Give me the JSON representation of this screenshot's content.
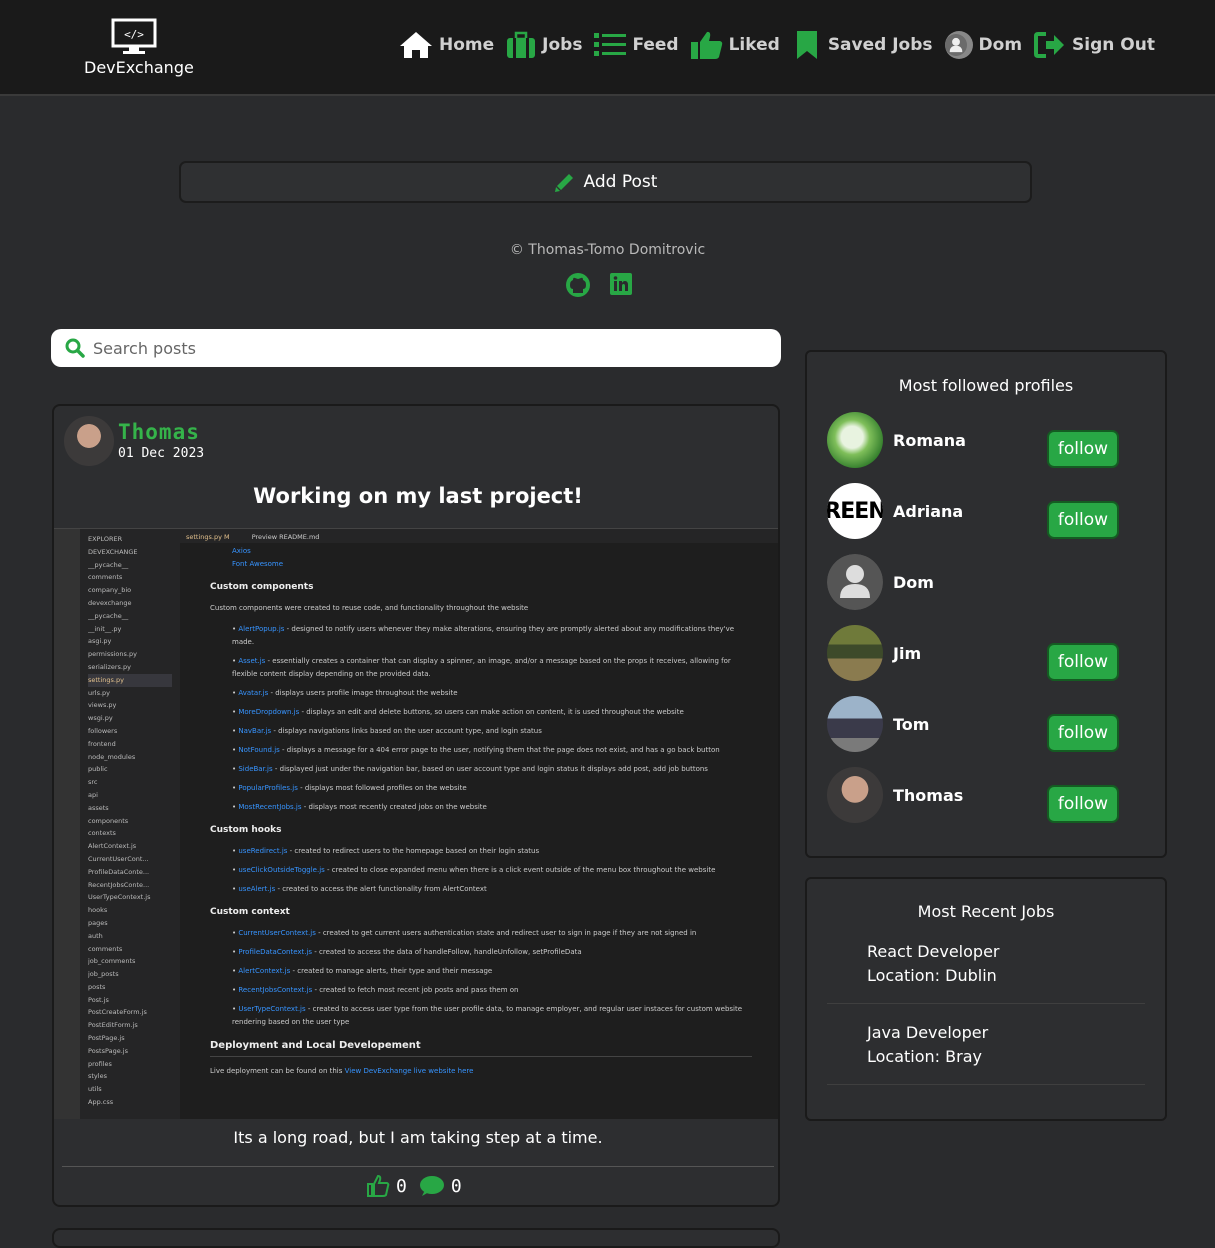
{
  "brand": {
    "name": "DevExchange"
  },
  "nav": {
    "items": [
      {
        "label": "Home",
        "icon": "home-icon"
      },
      {
        "label": "Jobs",
        "icon": "briefcase-icon"
      },
      {
        "label": "Feed",
        "icon": "list-icon"
      },
      {
        "label": "Liked",
        "icon": "thumbs-up-icon"
      },
      {
        "label": "Saved Jobs",
        "icon": "bookmark-icon"
      },
      {
        "label": "Dom",
        "icon": "avatar"
      },
      {
        "label": "Sign Out",
        "icon": "sign-out-icon"
      }
    ]
  },
  "add_post": {
    "label": "Add Post"
  },
  "footer": {
    "copyright": "© Thomas-Tomo Domitrovic"
  },
  "search": {
    "placeholder": "Search posts",
    "value": ""
  },
  "post": {
    "author": "Thomas",
    "date": "01 Dec 2023",
    "title": "Working on my last project!",
    "text": "Its a long road, but I am taking step at a time.",
    "likes": "0",
    "comments": "0"
  },
  "editor": {
    "tab1": "settings.py M",
    "tab2": "Preview README.md",
    "explorer": [
      "EXPLORER",
      "DEVEXCHANGE",
      "__pycache__",
      "comments",
      "company_bio",
      "devexchange",
      "__pycache__",
      "__init__.py",
      "asgi.py",
      "permissions.py",
      "serializers.py",
      "settings.py",
      "urls.py",
      "views.py",
      "wsgi.py",
      "followers",
      "frontend",
      "node_modules",
      "public",
      "src",
      "api",
      "assets",
      "components",
      "contexts",
      "AlertContext.js",
      "CurrentUserCont...",
      "ProfileDataConte...",
      "RecentJobsConte...",
      "UserTypeContext.js",
      "hooks",
      "pages",
      "auth",
      "comments",
      "job_comments",
      "job_posts",
      "posts",
      "Post.js",
      "PostCreateForm.js",
      "PostEditForm.js",
      "PostPage.js",
      "PostsPage.js",
      "profiles",
      "styles",
      "utils",
      "App.css"
    ],
    "top_links": [
      "Axios",
      "Font Awesome"
    ],
    "sections": [
      {
        "heading": "Custom components",
        "intro": "Custom components were created to reuse code, and functionality throughout the website",
        "items": [
          {
            "name": "AlertPopup.js",
            "desc": " - designed to notify users whenever they make alterations, ensuring they are promptly alerted about any modifications they've made."
          },
          {
            "name": "Asset.js",
            "desc": " - essentially creates a container that can display a spinner, an image, and/or a message based on the props it receives, allowing for flexible content display depending on the provided data."
          },
          {
            "name": "Avatar.js",
            "desc": " - displays users profile image throughout the website"
          },
          {
            "name": "MoreDropdown.js",
            "desc": " - displays an edit and delete buttons, so users can make action on content, it is used throughout the website"
          },
          {
            "name": "NavBar.js",
            "desc": " - displays navigations links based on the user account type, and login status"
          },
          {
            "name": "NotFound.js",
            "desc": " - displays a message for a 404 error page to the user, notifying them that the page does not exist, and has a go back button"
          },
          {
            "name": "SideBar.js",
            "desc": " - displayed just under the navigation bar, based on user account type and login status it displays add post, add job buttons"
          },
          {
            "name": "PopularProfiles.js",
            "desc": " - displays most followed profiles on the website"
          },
          {
            "name": "MostRecentJobs.js",
            "desc": " - displays most recently created jobs on the website"
          }
        ]
      },
      {
        "heading": "Custom hooks",
        "intro": "",
        "items": [
          {
            "name": "useRedirect.js",
            "desc": " - created to redirect users to the homepage based on their login status"
          },
          {
            "name": "useClickOutsideToggle.js",
            "desc": " - created to close expanded menu when there is a click event outside of the menu box throughout the website"
          },
          {
            "name": "useAlert.js",
            "desc": " - created to access the alert functionality from AlertContext"
          }
        ]
      },
      {
        "heading": "Custom context",
        "intro": "",
        "items": [
          {
            "name": "CurrentUserContext.js",
            "desc": " - created to get current users authentication state and redirect user to sign in page if they are not signed in"
          },
          {
            "name": "ProfileDataContext.js",
            "desc": " - created to access the data of handleFollow, handleUnfollow, setProfileData"
          },
          {
            "name": "AlertContext.js",
            "desc": " - created to manage alerts, their type and their message"
          },
          {
            "name": "RecentJobsContext.js",
            "desc": " - created to fetch most recent job posts and pass them on"
          },
          {
            "name": "UserTypeContext.js",
            "desc": " - created to access user type from the user profile data, to manage employer, and regular user instaces for custom website rendering based on the user type"
          }
        ]
      }
    ],
    "deploy_heading": "Deployment and Local Developement",
    "deploy_text": "Live deployment can be found on this ",
    "deploy_link": "View DevExchange live website here"
  },
  "profiles": {
    "title": "Most followed profiles",
    "follow_label": "follow",
    "items": [
      {
        "name": "Romana",
        "follow": true
      },
      {
        "name": "Adriana",
        "follow": true,
        "avatar_text": "REEN"
      },
      {
        "name": "Dom",
        "follow": false
      },
      {
        "name": "Jim",
        "follow": true
      },
      {
        "name": "Tom",
        "follow": true
      },
      {
        "name": "Thomas",
        "follow": true
      }
    ]
  },
  "jobs": {
    "title": "Most Recent Jobs",
    "items": [
      {
        "title": "React Developer",
        "location": "Location: Dublin"
      },
      {
        "title": "Java Developer",
        "location": "Location: Bray"
      }
    ]
  },
  "colors": {
    "accent": "#28a745",
    "author": "#35b34a",
    "bg": "#2a2b2d",
    "topbar": "#1a1a1a"
  }
}
